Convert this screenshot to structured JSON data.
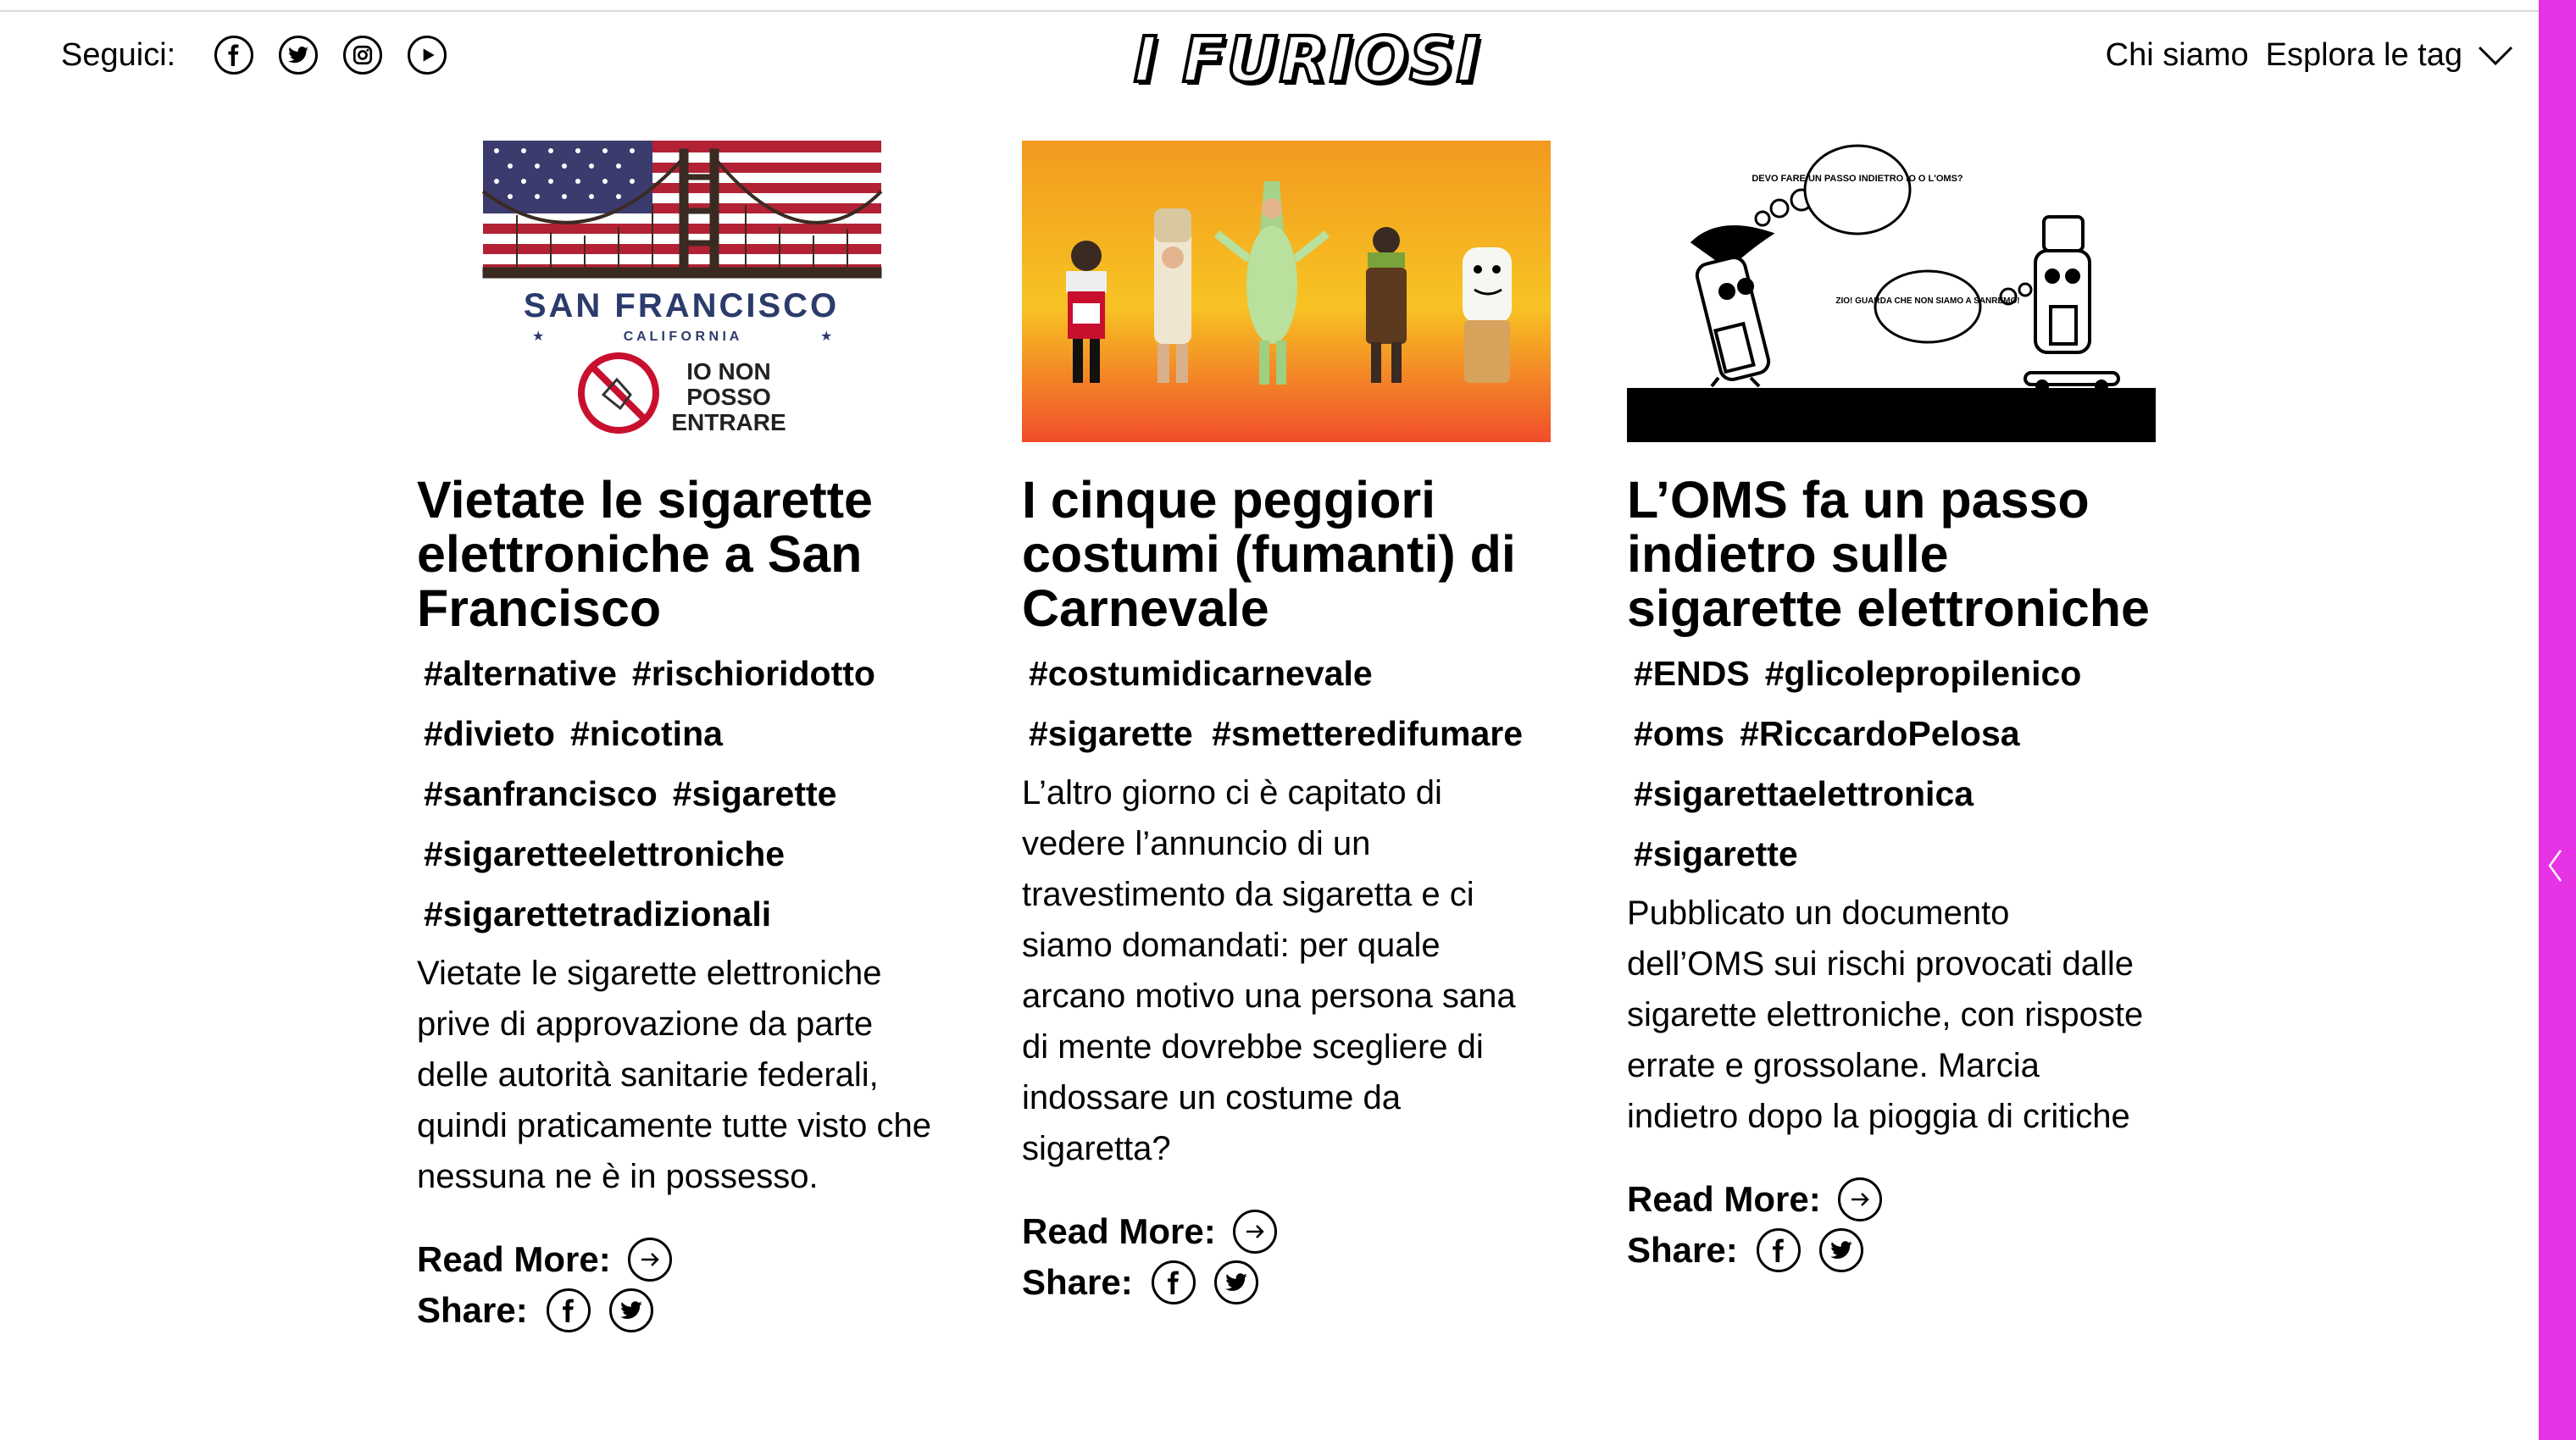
{
  "header": {
    "follow_label": "Seguici:",
    "social": [
      {
        "icon": "facebook-icon"
      },
      {
        "icon": "twitter-icon"
      },
      {
        "icon": "instagram-icon"
      },
      {
        "icon": "youtube-icon"
      }
    ],
    "logo": "I FURIOSI",
    "nav": {
      "about": "Chi siamo",
      "explore": "Esplora le tag"
    }
  },
  "colors": {
    "sidebar": "#e733e6",
    "text": "#000000",
    "background": "#ffffff"
  },
  "articles": [
    {
      "image": {
        "caption_main": "SAN FRANCISCO",
        "caption_sub": "C A L I F O R N I A",
        "badge_lines": [
          "IO NON",
          "POSSO",
          "ENTRARE"
        ]
      },
      "title": "Vietate le sigarette elettroniche a San Francisco",
      "tags": [
        "#alternative",
        "#rischioridotto",
        "#divieto",
        "#nicotina",
        "#sanfrancisco",
        "#sigarette",
        "#sigaretteelettroniche",
        "#sigarettetradizionali"
      ],
      "excerpt": "Vietate le sigarette elettroniche prive di approvazione da parte delle autorità sanitarie federali, quindi praticamente tutte visto che nessuna  ne è in possesso.",
      "read_more": "Read More:",
      "share": "Share:"
    },
    {
      "image": {},
      "title": "I cinque peggiori costumi (fumanti) di Carnevale",
      "tags": [
        "#costumidicarnevale",
        "#sigarette",
        "#smetteredifumare"
      ],
      "excerpt": "L’altro giorno ci è capitato di vedere l’annuncio di un travestimento da sigaretta e ci siamo domandati: per quale arcano motivo una persona sana di mente dovrebbe scegliere di indossare un costume da sigaretta?",
      "read_more": "Read More:",
      "share": "Share:"
    },
    {
      "image": {
        "bubble_left": "DEVO FARE UN PASSO INDIETRO IO O L'OMS?",
        "bubble_right": "ZIO! GUARDA CHE NON SIAMO A SANREMO!"
      },
      "title": "L’OMS fa un passo indietro sulle sigarette elettroniche",
      "tags": [
        "#ENDS",
        "#glicolepropilenico",
        "#oms",
        "#RiccardoPelosa",
        "#sigarettaelettronica",
        "#sigarette"
      ],
      "excerpt": "Pubblicato un documento dell’OMS sui rischi provocati dalle sigarette elettroniche, con risposte errate e grossolane. Marcia indietro dopo la pioggia di critiche",
      "read_more": "Read More:",
      "share": "Share:"
    }
  ]
}
